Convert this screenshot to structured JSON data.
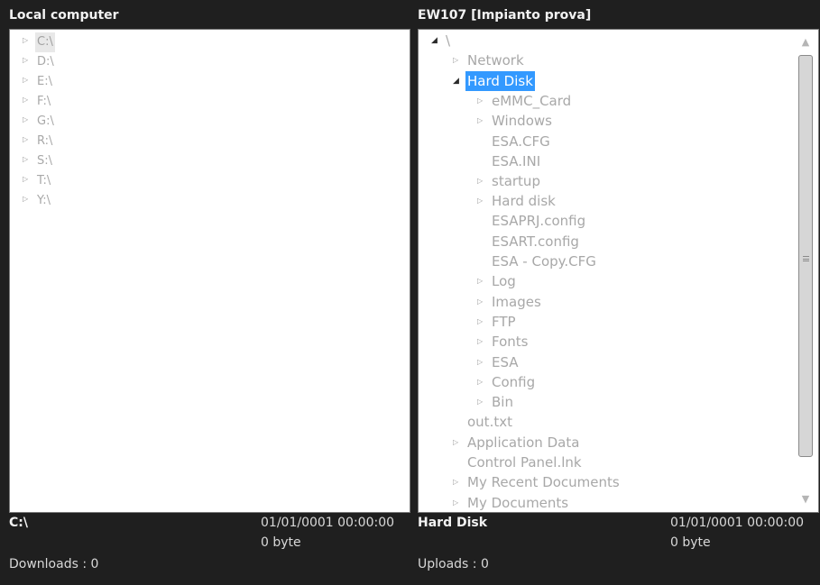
{
  "local": {
    "title": "Local computer",
    "drives": [
      {
        "label": "C:\\",
        "expander": "▷"
      },
      {
        "label": "D:\\",
        "expander": "▷"
      },
      {
        "label": "E:\\",
        "expander": "▷"
      },
      {
        "label": "F:\\",
        "expander": "▷"
      },
      {
        "label": "G:\\",
        "expander": "▷"
      },
      {
        "label": "R:\\",
        "expander": "▷"
      },
      {
        "label": "S:\\",
        "expander": "▷"
      },
      {
        "label": "T:\\",
        "expander": "▷"
      },
      {
        "label": "Y:\\",
        "expander": "▷"
      }
    ],
    "status": {
      "name": "C:\\",
      "date": "01/01/0001 00:00:00",
      "size": "0 byte",
      "transfers": "Downloads : 0"
    }
  },
  "remote": {
    "title": "EW107 [Impianto prova]",
    "tree": [
      {
        "label": "\\",
        "expander": "◢"
      },
      {
        "label": "Network",
        "expander": "▷"
      },
      {
        "label": "Hard Disk",
        "expander": "◢"
      },
      {
        "label": "eMMC_Card",
        "expander": "▷"
      },
      {
        "label": "Windows",
        "expander": "▷"
      },
      {
        "label": "ESA.CFG",
        "expander": ""
      },
      {
        "label": "ESA.INI",
        "expander": ""
      },
      {
        "label": "startup",
        "expander": "▷"
      },
      {
        "label": "Hard disk",
        "expander": "▷"
      },
      {
        "label": "ESAPRJ.config",
        "expander": ""
      },
      {
        "label": "ESART.config",
        "expander": ""
      },
      {
        "label": "ESA - Copy.CFG",
        "expander": ""
      },
      {
        "label": "Log",
        "expander": "▷"
      },
      {
        "label": "Images",
        "expander": "▷"
      },
      {
        "label": "FTP",
        "expander": "▷"
      },
      {
        "label": "Fonts",
        "expander": "▷"
      },
      {
        "label": "ESA",
        "expander": "▷"
      },
      {
        "label": "Config",
        "expander": "▷"
      },
      {
        "label": "Bin",
        "expander": "▷"
      },
      {
        "label": "out.txt",
        "expander": ""
      },
      {
        "label": "Application Data",
        "expander": "▷"
      },
      {
        "label": "Control Panel.lnk",
        "expander": ""
      },
      {
        "label": "My Recent Documents",
        "expander": "▷"
      },
      {
        "label": "My Documents",
        "expander": "▷"
      }
    ],
    "scrollbar": {
      "up": "▲",
      "down": "▼"
    },
    "status": {
      "name": "Hard Disk",
      "date": "01/01/0001 00:00:00",
      "size": "0 byte",
      "transfers": "Uploads : 0"
    }
  },
  "colors": {
    "background": "#1f1f1f",
    "selection": "#3399ff",
    "tree_text": "#a8a8a8"
  }
}
